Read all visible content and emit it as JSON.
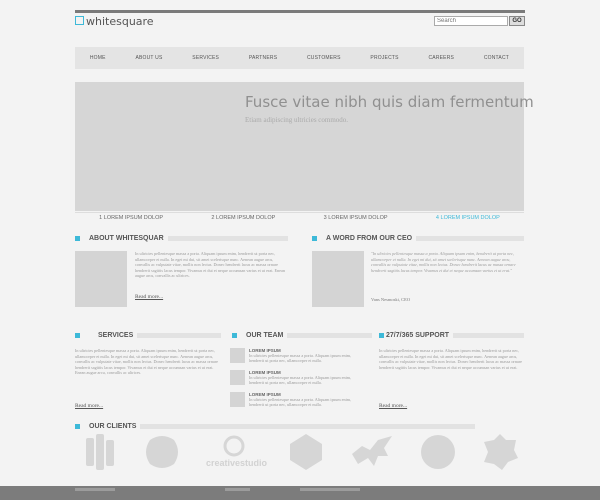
{
  "header": {
    "logo_text": "whitesquare",
    "search": {
      "placeholder": "Search",
      "button": "GO"
    }
  },
  "nav": [
    "HOME",
    "ABOUT US",
    "SERVICES",
    "PARTNERS",
    "CUSTOMERS",
    "PROJECTS",
    "CAREERS",
    "CONTACT"
  ],
  "hero": {
    "title": "Fusce vitae nibh quis diam fermentum",
    "subtitle": "Etiam adipiscing ultricies commodo."
  },
  "slides": [
    {
      "label": "1 LOREM IPSUM DOLOP",
      "active": false
    },
    {
      "label": "2 LOREM IPSUM DOLOP",
      "active": false
    },
    {
      "label": "3 LOREM IPSUM DOLOP",
      "active": false
    },
    {
      "label": "4 LOREM IPSUM DOLOP",
      "active": true
    }
  ],
  "about": {
    "title": "ABOUT WHITESQUAR",
    "text": "In ultricies pellentesque massa a porta. Aliquam ipsum enim, hendrerit ut porta nec, ullamcorper et nulla. In eget mi dui, sit amet scelerisque nunc. Aenean augue arcu, convallis ac vulputate vitae, mollis non lectus. Donec hendrerit lacus ac massa ornare hendrerit sagittis lacus tempor. Vivamus et dui et neque accumsan varius et ut erat. Enean augue arcu, convallis ac ultrices.",
    "read_more": "Read more..."
  },
  "ceo": {
    "title": "A WORD FROM OUR CEO",
    "text": "\"In ultricies pellentesque massa a porta. Aliquam ipsum enim, hendrerit ut porta nec, ullamcorper et nulla. In eget mi dui, sit amet scelerisque nunc. Aenean augue arcu, convallis ac vulputate vitae, mollis non lectus. Donec hendrerit lacus ac massa ornare hendrerit sagittis lacus tempor. Vivamus et dui et neque accumsan varius et ut erat.\"",
    "signature": "Vans Nesmoski, CEO"
  },
  "services": {
    "title": "SERVICES",
    "text": "In ultricies pellentesque massa a porta. Aliquam ipsum enim, hendrerit ut porta nec, ullamcorper et nulla. In eget mi dui, sit amet scelerisque nunc. Aenean augue arcu, convallis ac vulputate vitae, mollis non lectus. Donec hendrerit lacus ac massa ornare hendrerit sagittis lacus tempor. Vivamus et dui et neque accumsan varius et ut erat. Enean augue arcu, convallis ac ultrices.",
    "read_more": "Read more..."
  },
  "team": {
    "title": "OUR TEAM",
    "members": [
      {
        "name": "LOREM IPSUM",
        "text": "In ultricies pellentesque massa a porta. Aliquam ipsum enim, hendrerit ut porta nec, ullamcorper et nulla."
      },
      {
        "name": "LOREM IPSUM",
        "text": "In ultricies pellentesque massa a porta. Aliquam ipsum enim, hendrerit ut porta nec, ullamcorper et nulla."
      },
      {
        "name": "LOREM IPSUM",
        "text": "In ultricies pellentesque massa a porta. Aliquam ipsum enim, hendrerit ut porta nec, ullamcorper et nulla."
      }
    ]
  },
  "support": {
    "title": "27/7/365 SUPPORT",
    "text": "In ultricies pellentesque massa a porta. Aliquam ipsum enim, hendrerit ut porta nec, ullamcorper et nulla. In eget mi dui, sit amet scelerisque nunc. Aenean augue arcu, convallis ac vulputate vitae, mollis non lectus. Donec hendrerit lacus ac massa ornare hendrerit sagittis lacus tempor. Vivamus et dui et neque accumsan varius et ut erat.",
    "read_more": "Read more..."
  },
  "clients": {
    "title": "OUR CLIENTS",
    "logo_text": "creativestudio"
  },
  "colors": {
    "accent": "#3db9d8",
    "footer": "#7c7c7c"
  }
}
